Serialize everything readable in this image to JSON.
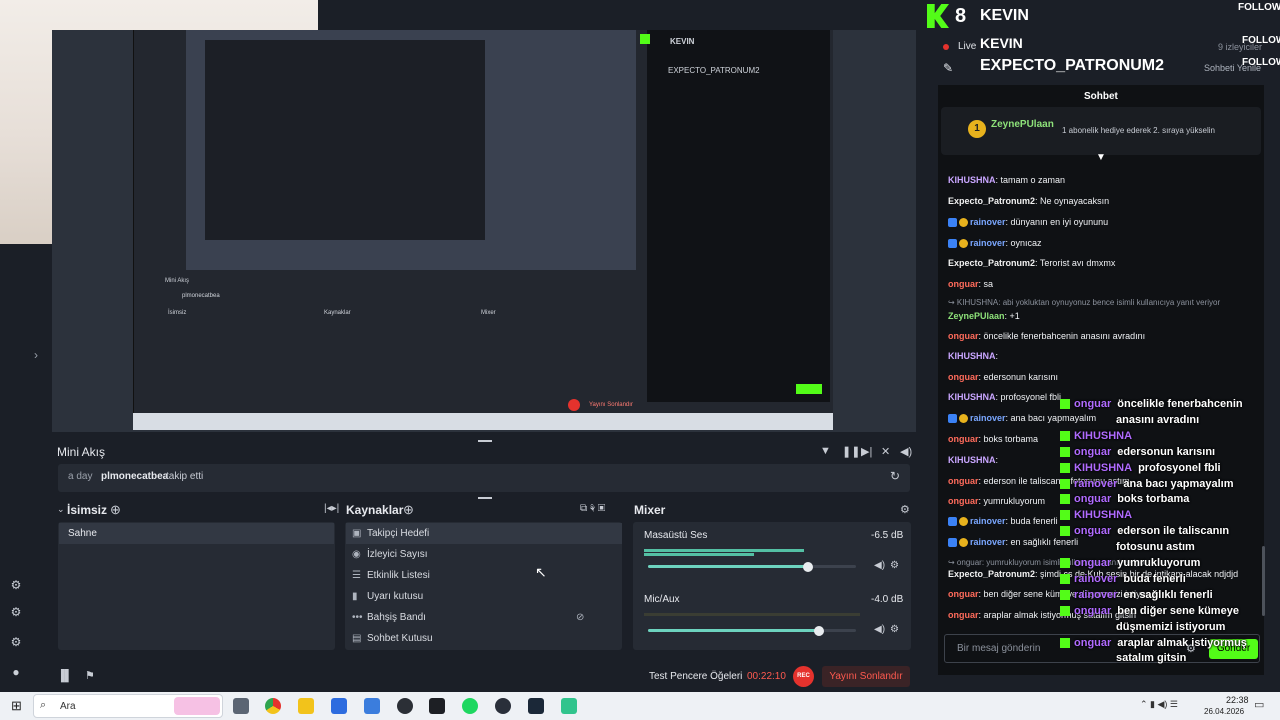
{
  "header": {
    "channel": "KEVIN",
    "badge_count": "8",
    "follow": "FOLLOW",
    "live": "Live",
    "viewers": "9 izleyiciler",
    "title": "EXPECTO_PATRONUM2",
    "chat_settings": "Sohbeti Yenile"
  },
  "mini_akis": {
    "title": "Mini Akış",
    "time": "a day",
    "user": "plmonecatbea",
    "action": "takip etti"
  },
  "scenes": {
    "title": "İsimsiz",
    "items": [
      "Sahne"
    ]
  },
  "sources": {
    "title": "Kaynaklar",
    "items": [
      {
        "icon": "globe-icon",
        "label": "Takipçi Hedefi"
      },
      {
        "icon": "eye-icon",
        "label": "İzleyici Sayısı"
      },
      {
        "icon": "list-icon",
        "label": "Etkinlik Listesi"
      },
      {
        "icon": "bell-icon",
        "label": "Uyarı kutusu"
      },
      {
        "icon": "dots-icon",
        "label": "Bahşiş Bandı"
      },
      {
        "icon": "chat-icon",
        "label": "Sohbet Kutusu"
      }
    ]
  },
  "mixer": {
    "title": "Mixer",
    "channels": [
      {
        "name": "Masaüstü Ses",
        "db": "-6.5 dB",
        "level": 0.77
      },
      {
        "name": "Mic/Aux",
        "db": "-4.0 dB",
        "level": 0.82
      }
    ]
  },
  "status": {
    "test": "Test Pencere Öğeleri",
    "timer": "00:22:10",
    "rec": "REC",
    "end": "Yayını Sonlandır"
  },
  "taskbar": {
    "search": "Ara",
    "time": "22:38",
    "date": "26.04.2026"
  },
  "chat": {
    "title": "Sohbet",
    "pinned_user": "ZeynePUlaan",
    "pinned_count": "1",
    "pinned_text": "1 abonelik hediye ederek 2. sıraya yükselin",
    "input_placeholder": "Bir mesaj gönderin",
    "send": "Gönder",
    "messages": [
      {
        "user": "KIHUSHNA",
        "text": ": tamam o zaman",
        "color": "purple"
      },
      {
        "user": "Expecto_Patronum2",
        "text": ": Ne oynayacaksın",
        "color": "white"
      },
      {
        "user": "rainover",
        "text": ": dünyanın en iyi oyununu",
        "color": "blue"
      },
      {
        "user": "rainover",
        "text": ": oynıcaz",
        "color": "blue"
      },
      {
        "user": "Expecto_Patronum2",
        "text": ": Terorist avı dmxmx",
        "color": "white"
      },
      {
        "user": "onguar",
        "text": ": sa",
        "color": "red"
      },
      {
        "user": "",
        "text": "↪ KIHUSHNA: abi yokluktan oynuyonuz bence isimli kullanıcıya yanıt veriyor",
        "color": "reply"
      },
      {
        "user": "ZeynePUlaan",
        "text": ": +1",
        "color": "green"
      },
      {
        "user": "onguar",
        "text": ": öncelikle fenerbahcenin anasını avradını",
        "color": "red"
      },
      {
        "user": "KIHUSHNA",
        "text": ":",
        "color": "purple"
      },
      {
        "user": "onguar",
        "text": ": edersonun karısını",
        "color": "red"
      },
      {
        "user": "KIHUSHNA",
        "text": ": profosyonel fbli",
        "color": "purple"
      },
      {
        "user": "rainover",
        "text": ": ana bacı yapmayalım",
        "color": "blue"
      },
      {
        "user": "onguar",
        "text": ": boks torbama",
        "color": "red"
      },
      {
        "user": "KIHUSHNA",
        "text": ":",
        "color": "purple"
      },
      {
        "user": "onguar",
        "text": ": ederson ile taliscanın fotosunu astım",
        "color": "red"
      },
      {
        "user": "onguar",
        "text": ": yumrukluyorum",
        "color": "red"
      },
      {
        "user": "rainover",
        "text": ": buda fenerli",
        "color": "blue"
      },
      {
        "user": "rainover",
        "text": ": en sağlıklı fenerli",
        "color": "blue"
      },
      {
        "user": "",
        "text": "↪ onguar: yumrukluyorum isimli kullanıcıya yanıt veriyor",
        "color": "reply"
      },
      {
        "user": "Expecto_Patronum2",
        "text": ": şimdi cs de Kub sesin bir de intikam alacak ndjdjd",
        "color": "white"
      },
      {
        "user": "onguar",
        "text": ": ben diğer sene kümeye düşmemizi istiyorum",
        "color": "red"
      },
      {
        "user": "onguar",
        "text": ": araplar almak istiyormuş satalım gitsin",
        "color": "red"
      }
    ]
  },
  "overlay": [
    {
      "user": "onguar",
      "text": "öncelikle fenerbahcenin"
    },
    {
      "user": "",
      "text": "anasını avradını"
    },
    {
      "user": "KIHUSHNA",
      "text": ""
    },
    {
      "user": "onguar",
      "text": "edersonun karısını"
    },
    {
      "user": "KIHUSHNA",
      "text": "profosyonel fbli"
    },
    {
      "user": "rainover",
      "text": "ana bacı yapmayalım"
    },
    {
      "user": "onguar",
      "text": "boks torbama"
    },
    {
      "user": "KIHUSHNA",
      "text": ""
    },
    {
      "user": "onguar",
      "text": "ederson ile taliscanın"
    },
    {
      "user": "",
      "text": "fotosunu astım"
    },
    {
      "user": "onguar",
      "text": "yumrukluyorum"
    },
    {
      "user": "rainover",
      "text": "buda fenerli"
    },
    {
      "user": "rainover",
      "text": "en sağlıklı fenerli"
    },
    {
      "user": "onguar",
      "text": "ben diğer sene kümeye"
    },
    {
      "user": "",
      "text": "düşmemizi istiyorum"
    },
    {
      "user": "onguar",
      "text": "araplar almak istiyormuş"
    },
    {
      "user": "",
      "text": "satalım gitsin"
    }
  ],
  "colors": {
    "kick_green": "#53fc18",
    "rec_red": "#e5322d",
    "accent_teal": "#54c0a4"
  }
}
